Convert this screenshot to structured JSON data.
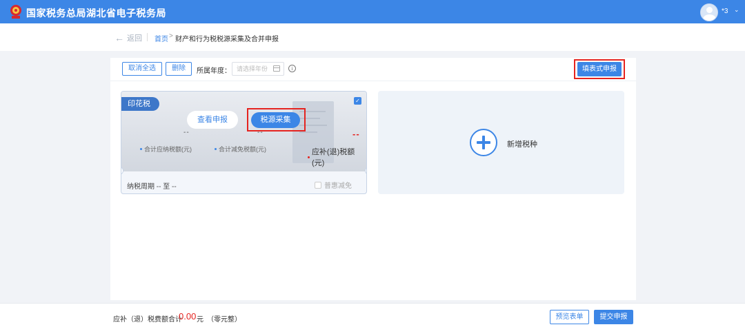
{
  "header": {
    "site_title": "国家税务总局湖北省电子税务局",
    "user_name": "*3",
    "user_caret": "⌄"
  },
  "breadcrumb": {
    "back_label": "返回",
    "home": "首页",
    "separator": ">",
    "current": "财产和行为税税源采集及合并申报"
  },
  "toolbar": {
    "cancel_all_label": "取消全选",
    "delete_label": "删除",
    "year_label": "所属年度：",
    "year_placeholder": "请选择年份",
    "fill_form_label": "填表式申报"
  },
  "tax_card": {
    "tag": "印花税",
    "view_button": "查看申报",
    "collect_button": "税源采集",
    "payable_value": "--",
    "reduction_value": "--",
    "refund_value": "--",
    "payable_label": "合计应纳税额(元)",
    "reduction_label": "合计减免税额(元)",
    "refund_label": "应补(退)税额(元)",
    "period": "纳税周期 -- 至 --",
    "preferential_label": "普惠减免",
    "checked": true
  },
  "add_card": {
    "label": "新增税种"
  },
  "footer": {
    "total_label": "应补（退）税费额合计",
    "total_amount": "0.00",
    "total_unit": "元",
    "total_words": "（零元整）",
    "preview_label": "预览表单",
    "submit_label": "提交申报"
  },
  "colors": {
    "brand_blue": "#3c86e6",
    "highlight_red": "#e5231f"
  }
}
